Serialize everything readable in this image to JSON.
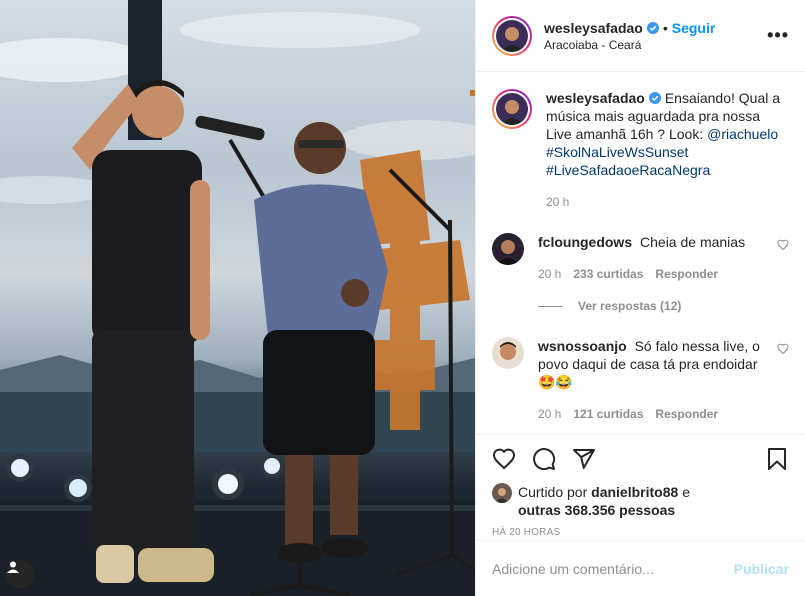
{
  "post": {
    "author": "wesleysafadao",
    "follow_label": "Seguir",
    "separator": "•",
    "location": "Aracoiaba - Ceará",
    "more_label": "•••"
  },
  "caption": {
    "username": "wesleysafadao",
    "text": "Ensaiando! Qual a música mais aguardada pra nossa Live amanhã 16h ? Look: ",
    "mention": "@riachuelo",
    "hashtags": [
      "#SkolNaLiveWsSunset",
      "#LiveSafadaoeRacaNegra"
    ],
    "time": "20 h"
  },
  "comments": [
    {
      "username": "fcloungedows",
      "text": "Cheia de manias",
      "time": "20 h",
      "likes": "233 curtidas",
      "reply_label": "Responder",
      "view_replies": "Ver respostas (12)"
    },
    {
      "username": "wsnossoanjo",
      "text": "Só falo nessa live, o povo daqui de casa tá pra endoidar 🤩😂",
      "time": "20 h",
      "likes": "121 curtidas",
      "reply_label": "Responder"
    }
  ],
  "likes": {
    "prefix": "Curtido por",
    "user": "danielbrito88",
    "conj": "e",
    "others": "outras 368.356 pessoas"
  },
  "posted_ago": "HÁ 20 HORAS",
  "add_comment": {
    "placeholder": "Adicione um comentário...",
    "publish_label": "Publicar"
  },
  "icons": {
    "like": "heart-icon",
    "comment": "comment-icon",
    "share": "share-icon",
    "save": "bookmark-icon",
    "verified": "verified-badge-icon",
    "tag": "user-tag-icon"
  },
  "colors": {
    "accent": "#0095f6",
    "link": "#00376b",
    "muted": "#8e8e8e",
    "verified": "#3897f0",
    "publish_disabled": "#b2dffc"
  }
}
